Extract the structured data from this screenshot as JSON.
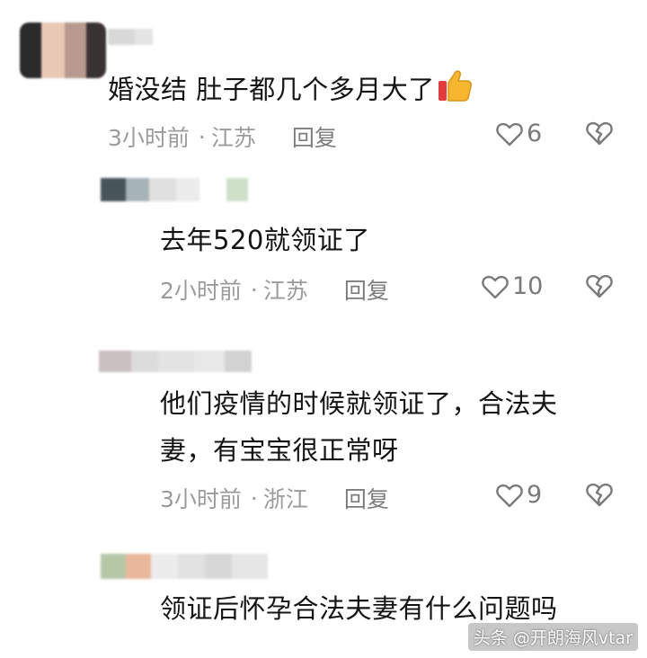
{
  "comments": [
    {
      "text": "婚没结 肚子都几个多月大了",
      "time": "3小时前",
      "location": "江苏",
      "reply": "回复",
      "likes": "6"
    },
    {
      "text": "去年520就领证了",
      "time": "2小时前",
      "location": "江苏",
      "reply": "回复",
      "likes": "10"
    },
    {
      "text_line1": "他们疫情的时候就领证了，合法夫",
      "text_line2": "妻，有宝宝很正常呀",
      "time": "3小时前",
      "location": "浙江",
      "reply": "回复",
      "likes": "9"
    },
    {
      "text": "领证后怀孕合法夫妻有什么问题吗"
    }
  ],
  "separator": "·",
  "watermark": "头条 @开朗海风vtar",
  "icons": {
    "like": "heart-outline-icon",
    "dislike": "broken-heart-icon",
    "emoji": "thumbs-up-emoji-icon"
  },
  "colors": {
    "text": "#141414",
    "meta": "#9b9b9b",
    "icon": "#7a7a7a"
  }
}
